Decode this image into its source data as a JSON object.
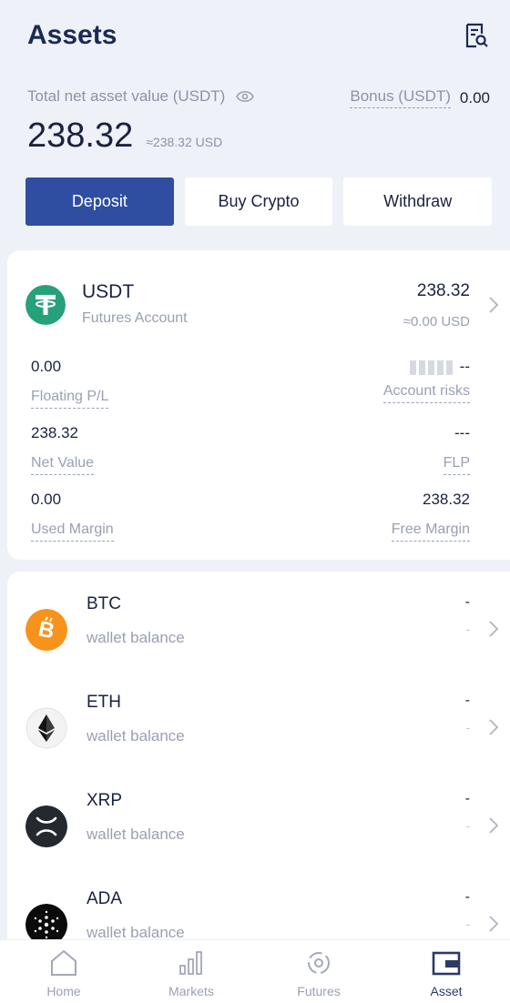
{
  "header": {
    "title": "Assets",
    "total_label": "Total net asset value (USDT)",
    "bonus_label": "Bonus (USDT)",
    "bonus_value": "0.00",
    "total_value": "238.32",
    "total_usd": "≈238.32 USD"
  },
  "actions": {
    "deposit": "Deposit",
    "buy_crypto": "Buy Crypto",
    "withdraw": "Withdraw"
  },
  "futures_account": {
    "coin": "USDT",
    "account": "Futures Account",
    "balance": "238.32",
    "balance_usd": "≈0.00 USD",
    "floating_pl_value": "0.00",
    "floating_pl_label": "Floating P/L",
    "account_risks_value": "--",
    "account_risks_label": "Account risks",
    "net_value_value": "238.32",
    "net_value_label": "Net Value",
    "flp_value": "---",
    "flp_label": "FLP",
    "used_margin_value": "0.00",
    "used_margin_label": "Used Margin",
    "free_margin_value": "238.32",
    "free_margin_label": "Free Margin"
  },
  "wallets": [
    {
      "coin": "BTC",
      "label": "wallet balance",
      "value": "-",
      "sub": "-",
      "icon": "btc-icon"
    },
    {
      "coin": "ETH",
      "label": "wallet balance",
      "value": "-",
      "sub": "-",
      "icon": "eth-icon"
    },
    {
      "coin": "XRP",
      "label": "wallet balance",
      "value": "-",
      "sub": "-",
      "icon": "xrp-icon"
    },
    {
      "coin": "ADA",
      "label": "wallet balance",
      "value": "-",
      "sub": "-",
      "icon": "ada-icon"
    }
  ],
  "tabs": [
    {
      "label": "Home",
      "icon": "home-icon"
    },
    {
      "label": "Markets",
      "icon": "markets-icon"
    },
    {
      "label": "Futures",
      "icon": "futures-icon"
    },
    {
      "label": "Asset",
      "icon": "wallet-icon",
      "active": true
    }
  ],
  "colors": {
    "primary": "#2f4ea1",
    "usdt": "#26a17b",
    "btc": "#f7931a",
    "background": "#eef1f8"
  }
}
